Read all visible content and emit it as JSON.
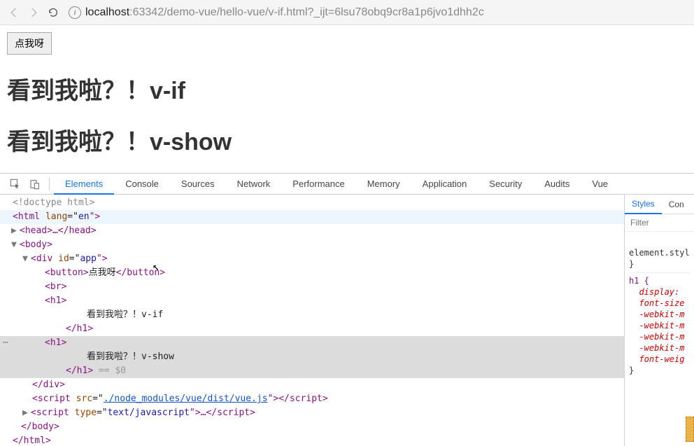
{
  "browser": {
    "url_host": "localhost",
    "url_rest": ":63342/demo-vue/hello-vue/v-if.html?_ijt=6lsu78obq9cr8a1p6jvo1dhh2c"
  },
  "page": {
    "button_label": "点我呀",
    "h1_a": "看到我啦？！v-if",
    "h1_b": "看到我啦？！v-show"
  },
  "devtools": {
    "tabs": [
      "Elements",
      "Console",
      "Sources",
      "Network",
      "Performance",
      "Memory",
      "Application",
      "Security",
      "Audits",
      "Vue"
    ],
    "active_tab": "Elements",
    "styles_tabs": [
      "Styles",
      "Con"
    ],
    "filter_placeholder": "Filter",
    "style_rules": {
      "rule1_selector": "element.styl",
      "rule1_close": "}",
      "rule2_selector": "h1 {",
      "rule2_props": [
        "display:",
        "font-size",
        "-webkit-m",
        "-webkit-m",
        "-webkit-m",
        "-webkit-m",
        "font-weig"
      ],
      "rule2_close": "}"
    }
  },
  "dom": {
    "l1": "<!doctype html>",
    "l2_open": "<",
    "l2_tag": "html",
    "l2_attr": " lang",
    "l2_eq": "=\"",
    "l2_val": "en",
    "l2_close": "\">",
    "l3_open": "<",
    "l3_tag": "head",
    "l3_mid": ">…</",
    "l3_close": ">",
    "l4_open": "<",
    "l4_tag": "body",
    "l4_close": ">",
    "l5_open": "<",
    "l5_tag": "div",
    "l5_attr": " id",
    "l5_eq": "=\"",
    "l5_val": "app",
    "l5_close": "\">",
    "l6_open": "<",
    "l6_tag": "button",
    "l6_mid": ">",
    "l6_text": "点我呀",
    "l6_close1": "</",
    "l6_close2": ">",
    "l7_open": "<",
    "l7_tag": "br",
    "l7_close": ">",
    "l8_open": "<",
    "l8_tag": "h1",
    "l8_close": ">",
    "l9_text": "看到我啦？！v-if",
    "l10_open": "</",
    "l10_tag": "h1",
    "l10_close": ">",
    "l11_open": "<",
    "l11_tag": "h1",
    "l11_close": ">",
    "l12_text": "看到我啦？！v-show",
    "l13_open": "</",
    "l13_tag": "h1",
    "l13_close": ">",
    "l13_eq0": " == $0",
    "l14_open": "</",
    "l14_tag": "div",
    "l14_close": ">",
    "l15_open": "<",
    "l15_tag": "script",
    "l15_attr": " src",
    "l15_eq": "=\"",
    "l15_val": "./node_modules/vue/dist/vue.js",
    "l15_mid": "\"></",
    "l15_close": ">",
    "l16_open": "<",
    "l16_tag": "script",
    "l16_attr": " type",
    "l16_eq": "=\"",
    "l16_val": "text/javascript",
    "l16_mid": "\">…</",
    "l16_close": ">",
    "l17_open": "</",
    "l17_tag": "body",
    "l17_close": ">",
    "l18_open": "</",
    "l18_tag": "html",
    "l18_close": ">"
  }
}
